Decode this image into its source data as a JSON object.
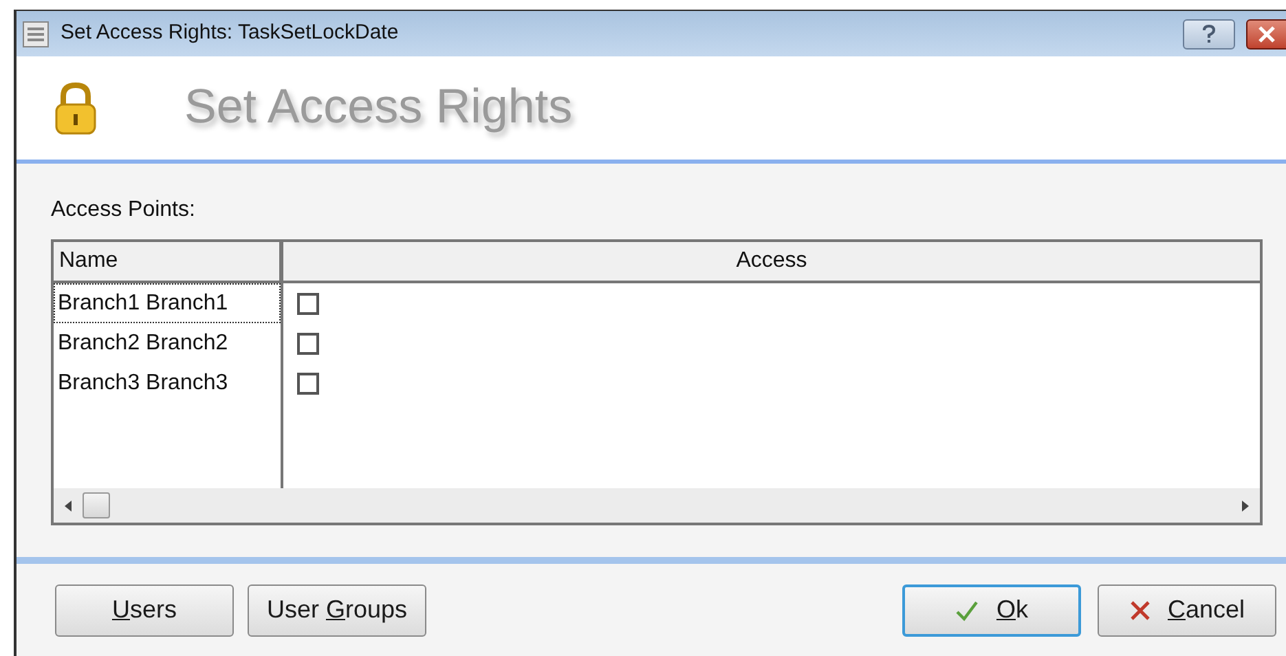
{
  "window": {
    "title": "Set Access Rights: TaskSetLockDate"
  },
  "header": {
    "title": "Set Access Rights"
  },
  "access_points": {
    "label": "Access Points:",
    "columns": [
      "Name",
      "Access"
    ],
    "rows": [
      {
        "name": "Branch1 Branch1",
        "checked": false,
        "focused": true
      },
      {
        "name": "Branch2 Branch2",
        "checked": false,
        "focused": false
      },
      {
        "name": "Branch3 Branch3",
        "checked": false,
        "focused": false
      }
    ]
  },
  "buttons": [
    {
      "kind": "plain",
      "accelerator": "U",
      "label_rest": "sers",
      "default": false
    },
    {
      "kind": "plain",
      "label_start": "User ",
      "accelerator": "G",
      "label_rest": "roups",
      "default": false
    },
    {
      "kind": "ok",
      "accelerator": "O",
      "label_rest": "k",
      "default": true
    },
    {
      "kind": "cancel",
      "accelerator": "C",
      "label_rest": "ancel",
      "default": false
    }
  ]
}
